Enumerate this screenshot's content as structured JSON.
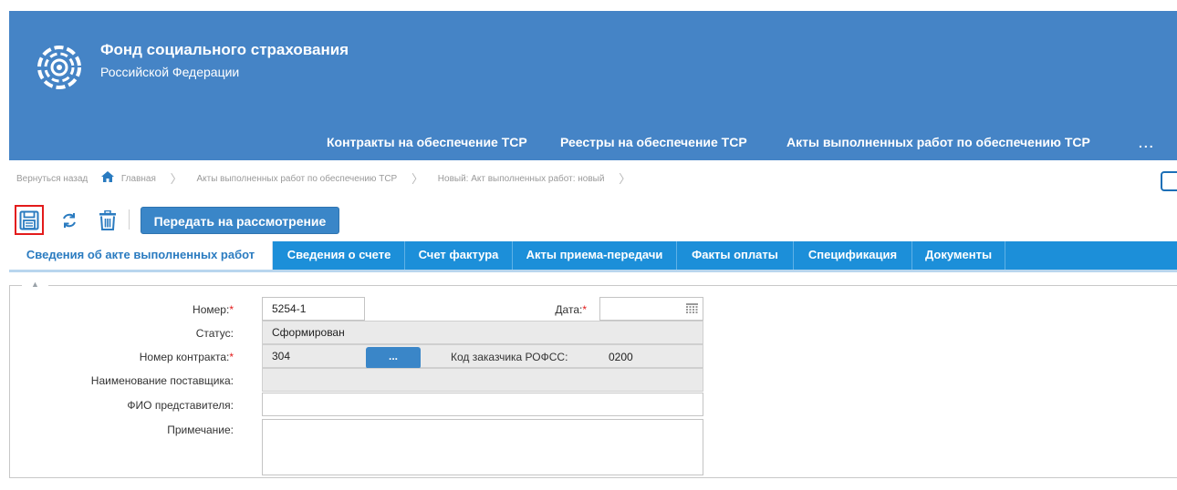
{
  "header": {
    "org_name": "Фонд социального страхования",
    "org_sub": "Российской Федерации",
    "nav": [
      {
        "label": "Контракты на обеспечение ТСР"
      },
      {
        "label": "Реестры на обеспечение ТСР"
      },
      {
        "label": "Акты выполненных работ по обеспечению ТСР"
      }
    ],
    "nav_more": "..."
  },
  "breadcrumb": {
    "back": "Вернуться назад",
    "home": "Главная",
    "level1": "Акты выполненных работ по обеспечению ТСР",
    "level2": "Новый: Акт выполненных работ: новый"
  },
  "toolbar": {
    "submit_label": "Передать на рассмотрение"
  },
  "tabs": [
    {
      "label": "Сведения об акте выполненных работ"
    },
    {
      "label": "Сведения о счете"
    },
    {
      "label": "Счет фактура"
    },
    {
      "label": "Акты приема-передачи"
    },
    {
      "label": "Факты оплаты"
    },
    {
      "label": "Спецификация"
    },
    {
      "label": "Документы"
    }
  ],
  "form": {
    "number_label": "Номер:",
    "number_value": "5254-1",
    "date_label": "Дата:",
    "date_value": "",
    "status_label": "Статус:",
    "status_value": "Сформирован",
    "contract_label": "Номер контракта:",
    "contract_value": "304",
    "browse_label": "...",
    "customer_code_label": "Код заказчика РОФСС:",
    "customer_code_value": "0200",
    "supplier_label": "Наименование поставщика:",
    "supplier_value": "",
    "rep_label": "ФИО представителя:",
    "rep_value": "",
    "note_label": "Примечание:",
    "note_value": "",
    "required_mark": "*"
  },
  "colors": {
    "header_bg": "#4584c6",
    "tab_bar": "#1c8fd9",
    "primary_button": "#3a86c8",
    "required": "#e31b1b"
  }
}
